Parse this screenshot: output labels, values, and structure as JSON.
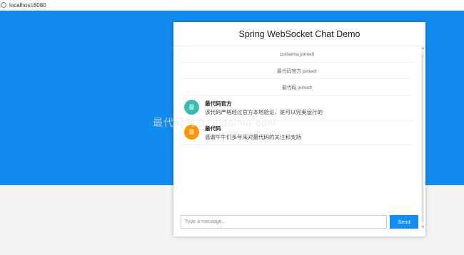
{
  "browser": {
    "url": "localhost:8080"
  },
  "chat": {
    "title": "Spring WebSocket Chat Demo",
    "events": [
      {
        "text": "zuidaima joined!"
      },
      {
        "text": "最代码官方 joined!"
      },
      {
        "text": "最代码 joined!"
      }
    ],
    "messages": [
      {
        "avatar": "最",
        "avatar_color": "#39bbb0",
        "sender": "最代码官方",
        "content": "该代码严格经过官方本地验证，是可以完美运行的"
      },
      {
        "avatar": "最",
        "avatar_color": "#ff9600",
        "sender": "最代码",
        "content": "感谢牛牛们多年来对最代码的关注和支持"
      }
    ],
    "input": {
      "placeholder": "Type a message...",
      "value": ""
    },
    "send_label": "Send"
  },
  "watermark": "最代码网@zuidaima.com",
  "colors": {
    "hero": "#128bf0",
    "send_button": "#138cf3"
  }
}
